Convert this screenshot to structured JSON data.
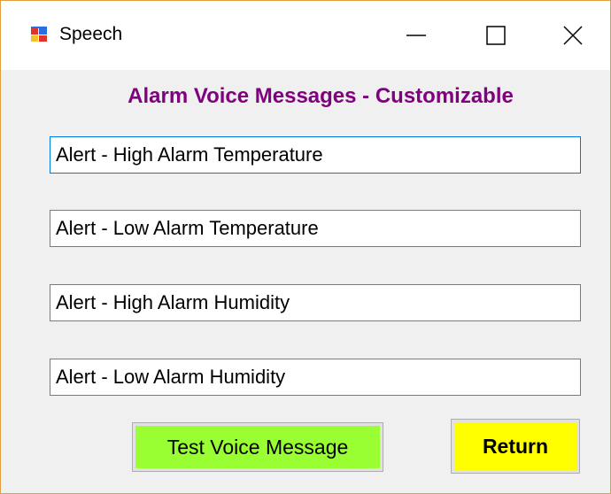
{
  "window": {
    "title": "Speech",
    "icon": "winforms-app-icon"
  },
  "caption_buttons": {
    "minimize_icon": "minimize-icon",
    "maximize_icon": "maximize-icon",
    "close_icon": "close-icon"
  },
  "heading": "Alarm Voice Messages - Customizable",
  "messages": [
    {
      "value": "Alert - High Alarm Temperature",
      "focused": true
    },
    {
      "value": "Alert - Low Alarm Temperature",
      "focused": false
    },
    {
      "value": "Alert - High Alarm Humidity",
      "focused": false
    },
    {
      "value": "Alert - Low Alarm Humidity",
      "focused": false
    }
  ],
  "buttons": {
    "test_label": "Test Voice Message",
    "return_label": "Return"
  },
  "colors": {
    "heading": "#800080",
    "test_button": "#99ff33",
    "return_button": "#ffff00",
    "focus_border": "#0078d7",
    "window_border": "#e0a040"
  }
}
